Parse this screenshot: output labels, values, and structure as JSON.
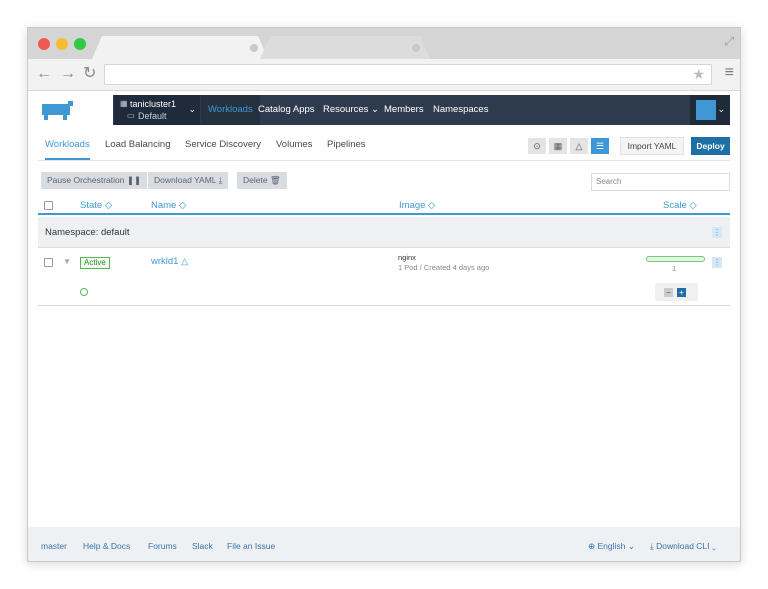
{
  "browser": {
    "url": ""
  },
  "cluster": {
    "name": "tanicluster1",
    "project": "Default"
  },
  "topnav": {
    "items": [
      {
        "label": "Workloads",
        "active": true
      },
      {
        "label": "Catalog Apps"
      },
      {
        "label": "Resources ⌄"
      },
      {
        "label": "Members"
      },
      {
        "label": "Namespaces"
      }
    ]
  },
  "subtabs": [
    {
      "label": "Workloads",
      "active": true
    },
    {
      "label": "Load Balancing"
    },
    {
      "label": "Service Discovery"
    },
    {
      "label": "Volumes"
    },
    {
      "label": "Pipelines"
    }
  ],
  "toolbar": {
    "import_label": "Import YAML",
    "deploy_label": "Deploy"
  },
  "actions": {
    "pause": "Pause Orchestration ❚❚",
    "download": "Download YAML ⤓",
    "delete": "Delete 🗑",
    "search_placeholder": "Search"
  },
  "table": {
    "headers": {
      "state": "State ◇",
      "name": "Name ◇",
      "image": "Image ◇",
      "scale": "Scale ◇"
    },
    "namespace": "Namespace: default",
    "rows": [
      {
        "state": "Active",
        "name": "wrkld1",
        "image": "nginx",
        "image_detail": "1 Pod / Created 4 days ago",
        "scale": "1",
        "scale_fill": 1.0
      }
    ]
  },
  "footer": {
    "links": [
      "master",
      "Help & Docs",
      "Forums",
      "Slack",
      "File an Issue"
    ],
    "language": "⊕ English ⌄",
    "cli": "⤓ Download CLI ⌄"
  },
  "colors": {
    "accent": "#3d98d3",
    "nav_bg": "#2e3b4f",
    "deploy": "#1d6fa5",
    "active_green": "#57b657"
  }
}
